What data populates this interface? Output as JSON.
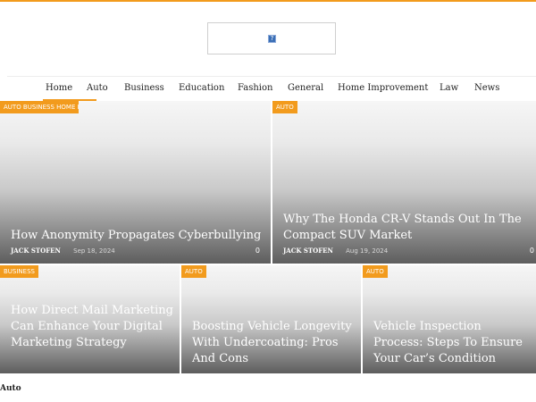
{
  "nav": {
    "items": [
      "Home",
      "Auto",
      "Business",
      "Education",
      "Fashion",
      "General",
      "Home Improvement",
      "Law",
      "News"
    ]
  },
  "colors": {
    "accent": "#f29b1d"
  },
  "logo": {
    "icon": "image-placeholder-icon",
    "glyph": "?"
  },
  "featured": [
    {
      "category": "AUTO BUSINESS HOME IMPROVEMENT",
      "title": "How Anonymity Propagates Cyberbullying",
      "author": "JACK STOFEN",
      "date": "Sep 18, 2024",
      "comments": "0"
    },
    {
      "category": "AUTO",
      "title": "Why The Honda CR-V Stands Out In The Compact SUV Market",
      "author": "JACK STOFEN",
      "date": "Aug 19, 2024",
      "comments": "0"
    },
    {
      "category": "BUSINESS",
      "title": "How Direct Mail Marketing Can Enhance Your Digital Marketing Strategy"
    },
    {
      "category": "AUTO",
      "title": "Boosting Vehicle Longevity With Undercoating: Pros And Cons"
    },
    {
      "category": "AUTO",
      "title": "Vehicle Inspection Process: Steps To Ensure Your Car’s Condition"
    }
  ],
  "section": {
    "label": "Auto"
  }
}
